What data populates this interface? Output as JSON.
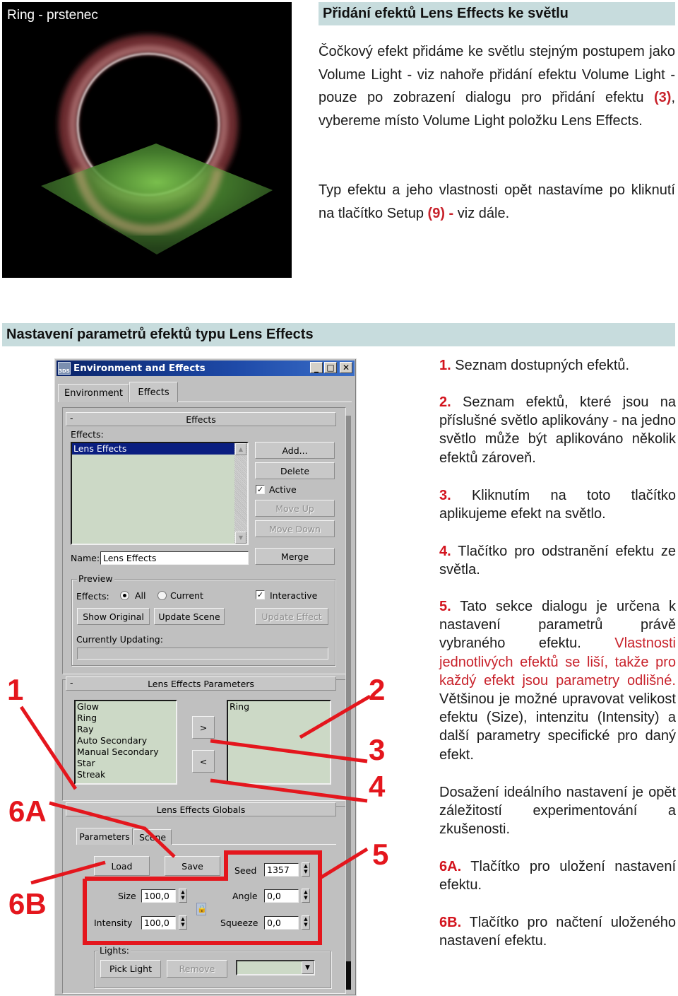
{
  "render": {
    "caption": "Ring - prstenec",
    "colors": {
      "background": "#000000",
      "ring": "#b06a6a",
      "plane": "#5a9a3a"
    }
  },
  "section1": {
    "heading": "Přidání efektů Lens Effects ke světlu",
    "para1": {
      "before": "Čočkový efekt přidáme ke světlu stejným postupem jako Volume Light - viz nahoře přidání efektu Volume Light - pouze po zobrazení dialogu pro přidání efektu ",
      "ref": "(3)",
      "after": ", vybereme místo Volume Light položku Lens Effects."
    },
    "para2": {
      "before": "Typ efektu a jeho vlastnosti opět nastavíme po kliknutí na tlačítko Setup ",
      "ref": "(9) -",
      "after": " viz dále."
    }
  },
  "section2": {
    "heading": "Nastavení parametrů efektů typu Lens Effects"
  },
  "notes": [
    {
      "num": "1.",
      "text": " Seznam dostupných efektů."
    },
    {
      "num": "2.",
      "text": " Seznam efektů, které jsou na příslušné světlo aplikovány - na jedno světlo může být aplikováno několik efektů zároveň."
    },
    {
      "num": "3.",
      "text": " Kliknutím na toto tlačítko aplikujeme efekt na světlo."
    },
    {
      "num": "4.",
      "text": " Tlačítko pro odstranění efektu ze světla."
    },
    {
      "num": "5.",
      "text": " Tato sekce dialogu je určena k nastavení parametrů právě vybraného efektu. ",
      "red": "Vlastnosti jednotlivých efektů se liší, takže pro každý efekt jsou parametry odlišné.",
      "after": " Většinou je možné upravovat velikost efektu (Size), intenzitu (Intensity) a další parametry specifické pro daný efekt."
    },
    {
      "num": "",
      "text": "Dosažení ideálního nastavení je opět záležitostí experimentování a zkušenosti."
    },
    {
      "num": "6A.",
      "text": " Tlačítko pro uložení nastavení efektu."
    },
    {
      "num": "6B.",
      "text": " Tlačítko pro načtení uloženého nastavení efektu."
    }
  ],
  "dialog": {
    "title": "Environment and Effects",
    "app_icon": "3DS",
    "title_buttons": {
      "minimize": "_",
      "maximize": "□",
      "close": "✕"
    },
    "tabs": [
      "Environment",
      "Effects"
    ],
    "active_tab": "Effects",
    "effects_rollout": {
      "title": "Effects",
      "collapse": "-",
      "effects_label": "Effects:",
      "effects_list": [
        "Lens Effects"
      ],
      "selected": "Lens Effects",
      "buttons": {
        "add": "Add...",
        "delete": "Delete",
        "move_up": "Move Up",
        "move_down": "Move Down",
        "merge": "Merge"
      },
      "active_label": "Active",
      "active_checked": true,
      "name_label": "Name:",
      "name_value": "Lens Effects",
      "preview": {
        "title": "Preview",
        "effects_label": "Effects:",
        "radio_all": "All",
        "radio_current": "Current",
        "selected_radio": "All",
        "interactive_label": "Interactive",
        "interactive_checked": true,
        "show_original": "Show Original",
        "update_scene": "Update Scene",
        "update_effect": "Update Effect",
        "currently_updating": "Currently Updating:"
      }
    },
    "lens_params": {
      "title": "Lens Effects Parameters",
      "collapse": "-",
      "available": [
        "Glow",
        "Ring",
        "Ray",
        "Auto Secondary",
        "Manual Secondary",
        "Star",
        "Streak"
      ],
      "applied": [
        "Ring"
      ],
      "add_arrow": ">",
      "remove_arrow": "<"
    },
    "lens_globals": {
      "title": "Lens Effects Globals",
      "tabs": [
        "Parameters",
        "Scene"
      ],
      "active_tab": "Parameters",
      "load": "Load",
      "save": "Save",
      "seed_label": "Seed",
      "seed": "1357",
      "size_label": "Size",
      "size": "100,0",
      "angle_label": "Angle",
      "angle": "0,0",
      "intensity_label": "Intensity",
      "intensity": "100,0",
      "squeeze_label": "Squeeze",
      "squeeze": "0,0",
      "lights_title": "Lights:",
      "pick_light": "Pick Light",
      "remove": "Remove",
      "lights_dropdown": ""
    }
  },
  "callouts": {
    "labels": [
      "1",
      "2",
      "3",
      "4",
      "5",
      "6A",
      "6B"
    ],
    "color": "#e4161d"
  }
}
